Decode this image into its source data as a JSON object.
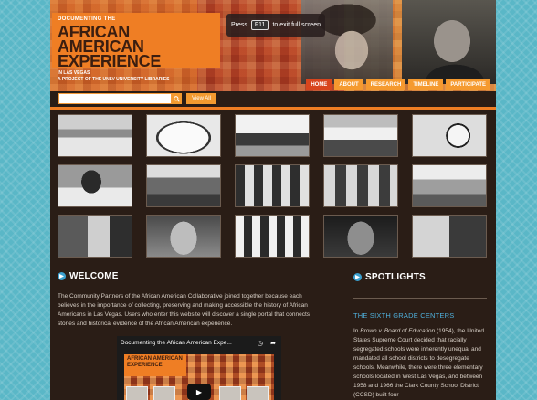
{
  "header": {
    "title_top": "DOCUMENTING THE",
    "title_main_line1": "AFRICAN AMERICAN",
    "title_main_line2": "EXPERIENCE",
    "title_sub": "IN LAS VEGAS",
    "title_project": "A PROJECT OF THE UNLV UNIVERSITY LIBRARIES"
  },
  "fullscreen_notice": {
    "prefix": "Press",
    "key": "F11",
    "suffix": "to exit full screen"
  },
  "nav": [
    {
      "label": "HOME",
      "active": true
    },
    {
      "label": "ABOUT",
      "active": false
    },
    {
      "label": "RESEARCH",
      "active": false
    },
    {
      "label": "TIMELINE",
      "active": false
    },
    {
      "label": "PARTICIPATE",
      "active": false
    }
  ],
  "search": {
    "value": "",
    "button_icon": "search-icon",
    "view_all": "View All"
  },
  "welcome": {
    "heading": "WELCOME",
    "text": "The Community Partners of the African American Collaborative joined together because each believes in the importance of collecting, preserving and making accessible the history of African Americans in Las Vegas. Users who enter this website will discover a single portal that connects stories and historical evidence of the African American experience."
  },
  "video": {
    "title": "Documenting the African American Expe...",
    "thumb_title_line1": "AFRICAN AMERICAN",
    "thumb_title_line2": "EXPERIENCE",
    "play_icon": "play-icon",
    "clock_icon": "clock-icon",
    "share_icon": "share-icon"
  },
  "spotlights": {
    "heading": "SPOTLIGHTS",
    "title": "THE SIXTH GRADE CENTERS",
    "text_before_em": "In ",
    "text_em": "Brown v. Board of Education",
    "text_after": " (1954), the United States Supreme Court decided that racially segregated schools were inherently unequal and mandated all school districts to desegregate schools.  Meanwhile, there were three elementary schools located in West Las Vegas, and between 1958 and 1966 the Clark County School District (CCSD) built four"
  },
  "colors": {
    "page_bg": "#5ab7c7",
    "site_bg": "#2a1d16",
    "accent_orange": "#ef7e24",
    "nav_orange": "#f59a2f",
    "nav_active": "#d8451d",
    "link_blue": "#4fb0dc"
  }
}
